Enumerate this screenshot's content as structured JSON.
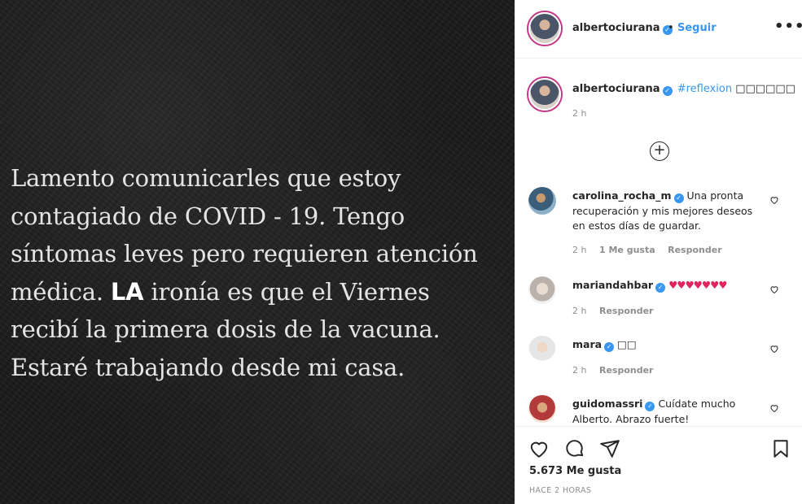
{
  "post": {
    "text_before_emph": "Lamento comunicarles que estoy contagiado de COVID - 19. Tengo síntomas leves pero requieren atención médica. ",
    "text_emph": "LA",
    "text_after_emph": " ironía es que el Viernes recibí la primera dosis de la vacuna. Estaré trabajando desde mi casa."
  },
  "header": {
    "username": "albertociurana",
    "separator": "•",
    "follow_label": "Seguir",
    "more_label": "•••"
  },
  "caption": {
    "username": "albertociurana",
    "hashtag": "#reflexion",
    "trailing": "□□□□□□",
    "time": "2 h"
  },
  "load_more_label": "+",
  "comments": [
    {
      "username": "carolina_rocha_m",
      "text": "Una pronta recuperación y mis mejores deseos en estos días de guardar.",
      "time": "2 h",
      "likes": "1 Me gusta",
      "reply": "Responder"
    },
    {
      "username": "mariandahbar",
      "text": "♥♥♥♥♥♥♥",
      "time": "2 h",
      "reply": "Responder"
    },
    {
      "username": "mara",
      "text": "□□",
      "time": "2 h",
      "reply": "Responder"
    },
    {
      "username": "guidomassri",
      "text": "Cuídate mucho Alberto. Abrazo fuerte!"
    }
  ],
  "footer": {
    "likes": "5.673 Me gusta",
    "time_ago": "HACE 2 HORAS"
  },
  "colors": {
    "accent": "#3897f0",
    "heart": "#e0245e",
    "image_bg": "#1b1b1b"
  }
}
